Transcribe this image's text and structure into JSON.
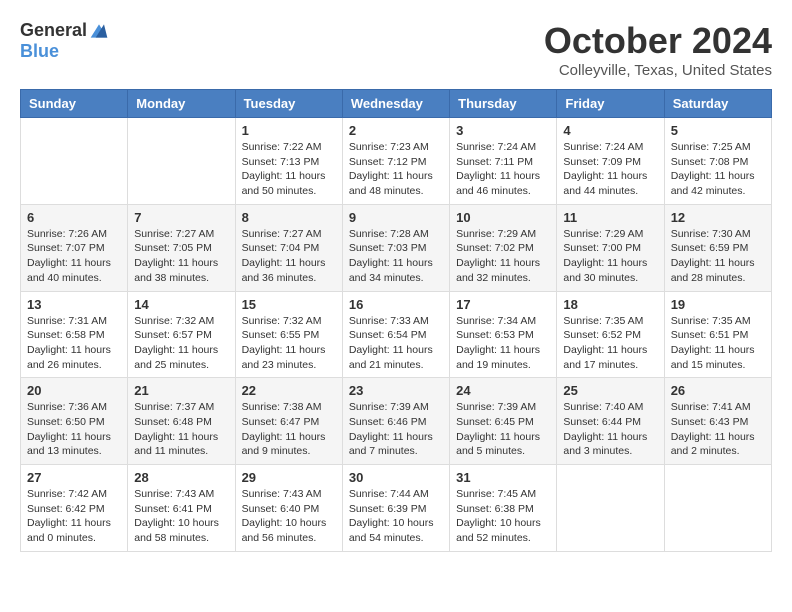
{
  "header": {
    "logo_general": "General",
    "logo_blue": "Blue",
    "title": "October 2024",
    "location": "Colleyville, Texas, United States"
  },
  "weekdays": [
    "Sunday",
    "Monday",
    "Tuesday",
    "Wednesday",
    "Thursday",
    "Friday",
    "Saturday"
  ],
  "weeks": [
    [
      {
        "day": "",
        "info": ""
      },
      {
        "day": "",
        "info": ""
      },
      {
        "day": "1",
        "info": "Sunrise: 7:22 AM\nSunset: 7:13 PM\nDaylight: 11 hours and 50 minutes."
      },
      {
        "day": "2",
        "info": "Sunrise: 7:23 AM\nSunset: 7:12 PM\nDaylight: 11 hours and 48 minutes."
      },
      {
        "day": "3",
        "info": "Sunrise: 7:24 AM\nSunset: 7:11 PM\nDaylight: 11 hours and 46 minutes."
      },
      {
        "day": "4",
        "info": "Sunrise: 7:24 AM\nSunset: 7:09 PM\nDaylight: 11 hours and 44 minutes."
      },
      {
        "day": "5",
        "info": "Sunrise: 7:25 AM\nSunset: 7:08 PM\nDaylight: 11 hours and 42 minutes."
      }
    ],
    [
      {
        "day": "6",
        "info": "Sunrise: 7:26 AM\nSunset: 7:07 PM\nDaylight: 11 hours and 40 minutes."
      },
      {
        "day": "7",
        "info": "Sunrise: 7:27 AM\nSunset: 7:05 PM\nDaylight: 11 hours and 38 minutes."
      },
      {
        "day": "8",
        "info": "Sunrise: 7:27 AM\nSunset: 7:04 PM\nDaylight: 11 hours and 36 minutes."
      },
      {
        "day": "9",
        "info": "Sunrise: 7:28 AM\nSunset: 7:03 PM\nDaylight: 11 hours and 34 minutes."
      },
      {
        "day": "10",
        "info": "Sunrise: 7:29 AM\nSunset: 7:02 PM\nDaylight: 11 hours and 32 minutes."
      },
      {
        "day": "11",
        "info": "Sunrise: 7:29 AM\nSunset: 7:00 PM\nDaylight: 11 hours and 30 minutes."
      },
      {
        "day": "12",
        "info": "Sunrise: 7:30 AM\nSunset: 6:59 PM\nDaylight: 11 hours and 28 minutes."
      }
    ],
    [
      {
        "day": "13",
        "info": "Sunrise: 7:31 AM\nSunset: 6:58 PM\nDaylight: 11 hours and 26 minutes."
      },
      {
        "day": "14",
        "info": "Sunrise: 7:32 AM\nSunset: 6:57 PM\nDaylight: 11 hours and 25 minutes."
      },
      {
        "day": "15",
        "info": "Sunrise: 7:32 AM\nSunset: 6:55 PM\nDaylight: 11 hours and 23 minutes."
      },
      {
        "day": "16",
        "info": "Sunrise: 7:33 AM\nSunset: 6:54 PM\nDaylight: 11 hours and 21 minutes."
      },
      {
        "day": "17",
        "info": "Sunrise: 7:34 AM\nSunset: 6:53 PM\nDaylight: 11 hours and 19 minutes."
      },
      {
        "day": "18",
        "info": "Sunrise: 7:35 AM\nSunset: 6:52 PM\nDaylight: 11 hours and 17 minutes."
      },
      {
        "day": "19",
        "info": "Sunrise: 7:35 AM\nSunset: 6:51 PM\nDaylight: 11 hours and 15 minutes."
      }
    ],
    [
      {
        "day": "20",
        "info": "Sunrise: 7:36 AM\nSunset: 6:50 PM\nDaylight: 11 hours and 13 minutes."
      },
      {
        "day": "21",
        "info": "Sunrise: 7:37 AM\nSunset: 6:48 PM\nDaylight: 11 hours and 11 minutes."
      },
      {
        "day": "22",
        "info": "Sunrise: 7:38 AM\nSunset: 6:47 PM\nDaylight: 11 hours and 9 minutes."
      },
      {
        "day": "23",
        "info": "Sunrise: 7:39 AM\nSunset: 6:46 PM\nDaylight: 11 hours and 7 minutes."
      },
      {
        "day": "24",
        "info": "Sunrise: 7:39 AM\nSunset: 6:45 PM\nDaylight: 11 hours and 5 minutes."
      },
      {
        "day": "25",
        "info": "Sunrise: 7:40 AM\nSunset: 6:44 PM\nDaylight: 11 hours and 3 minutes."
      },
      {
        "day": "26",
        "info": "Sunrise: 7:41 AM\nSunset: 6:43 PM\nDaylight: 11 hours and 2 minutes."
      }
    ],
    [
      {
        "day": "27",
        "info": "Sunrise: 7:42 AM\nSunset: 6:42 PM\nDaylight: 11 hours and 0 minutes."
      },
      {
        "day": "28",
        "info": "Sunrise: 7:43 AM\nSunset: 6:41 PM\nDaylight: 10 hours and 58 minutes."
      },
      {
        "day": "29",
        "info": "Sunrise: 7:43 AM\nSunset: 6:40 PM\nDaylight: 10 hours and 56 minutes."
      },
      {
        "day": "30",
        "info": "Sunrise: 7:44 AM\nSunset: 6:39 PM\nDaylight: 10 hours and 54 minutes."
      },
      {
        "day": "31",
        "info": "Sunrise: 7:45 AM\nSunset: 6:38 PM\nDaylight: 10 hours and 52 minutes."
      },
      {
        "day": "",
        "info": ""
      },
      {
        "day": "",
        "info": ""
      }
    ]
  ]
}
